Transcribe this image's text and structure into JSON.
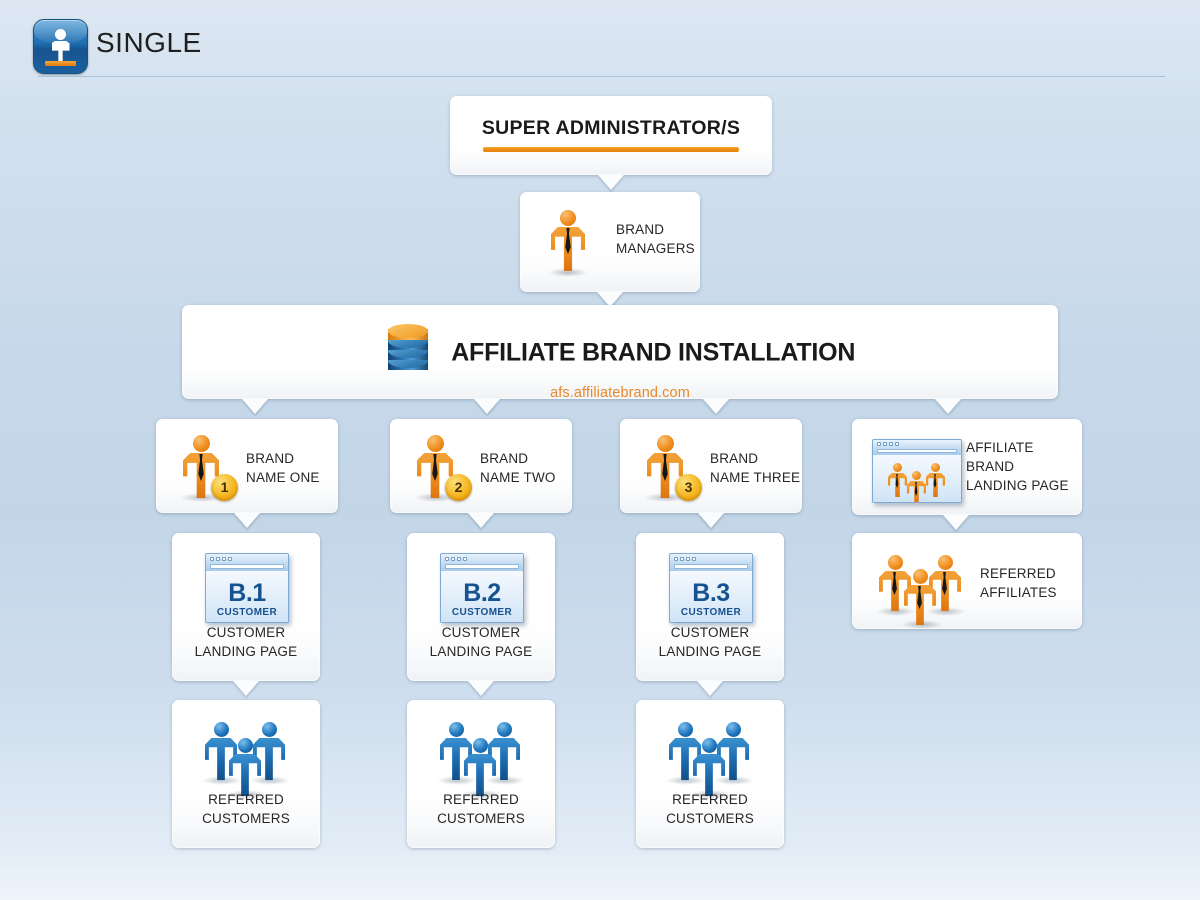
{
  "header": {
    "app_title": "SINGLE",
    "icon": "single-person-app-icon"
  },
  "diagram": {
    "super_admin": {
      "title": "SUPER  ADMINISTRATOR/S",
      "accent_color": "#ef8f17"
    },
    "brand_managers": {
      "label_line1": "BRAND",
      "label_line2": "MANAGERS",
      "icon": "orange-businessperson-icon"
    },
    "installation": {
      "title": "AFFILIATE BRAND INSTALLATION",
      "url": "afs.affiliatebrand.com",
      "url_color": "#e8892a",
      "icon": "database-icon"
    },
    "brands": [
      {
        "badge": "1",
        "label_line1": "BRAND",
        "label_line2": "NAME ONE",
        "landing": {
          "browser_title": "B.1",
          "browser_sub": "CUSTOMER",
          "caption_line1": "CUSTOMER",
          "caption_line2": "LANDING PAGE"
        },
        "referred": {
          "caption_line1": "REFERRED",
          "caption_line2": "CUSTOMERS",
          "icon": "three-blue-people-icon"
        }
      },
      {
        "badge": "2",
        "label_line1": "BRAND",
        "label_line2": "NAME TWO",
        "landing": {
          "browser_title": "B.2",
          "browser_sub": "CUSTOMER",
          "caption_line1": "CUSTOMER",
          "caption_line2": "LANDING PAGE"
        },
        "referred": {
          "caption_line1": "REFERRED",
          "caption_line2": "CUSTOMERS",
          "icon": "three-blue-people-icon"
        }
      },
      {
        "badge": "3",
        "label_line1": "BRAND",
        "label_line2": "NAME THREE",
        "landing": {
          "browser_title": "B.3",
          "browser_sub": "CUSTOMER",
          "caption_line1": "CUSTOMER",
          "caption_line2": "LANDING PAGE"
        },
        "referred": {
          "caption_line1": "REFERRED",
          "caption_line2": "CUSTOMERS",
          "icon": "three-blue-people-icon"
        }
      }
    ],
    "affiliate_landing": {
      "label_line1": "AFFILIATE",
      "label_line2": "BRAND",
      "label_line3": "LANDING PAGE",
      "icon": "browser-with-orange-people-icon"
    },
    "referred_affiliates": {
      "label_line1": "REFERRED",
      "label_line2": "AFFILIATES",
      "icon": "three-orange-people-icon"
    }
  }
}
